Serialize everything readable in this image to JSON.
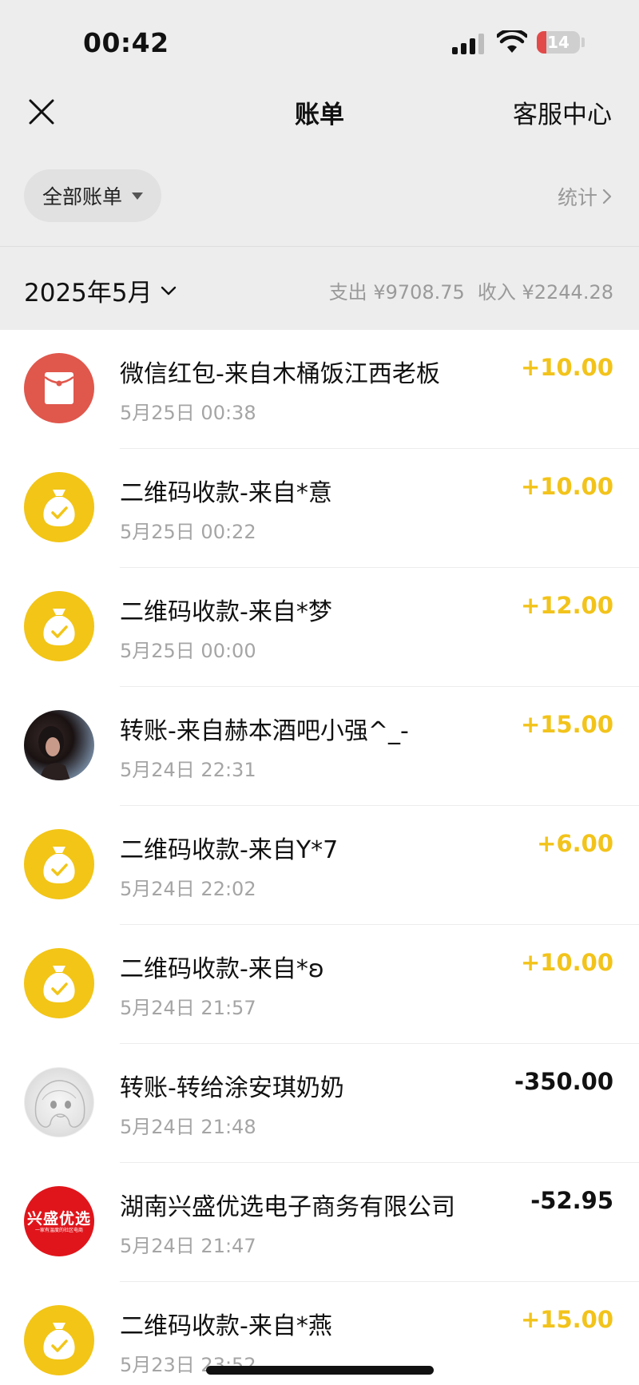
{
  "status_bar": {
    "time": "00:42",
    "battery": "14",
    "battery_level_percent": 14
  },
  "nav": {
    "title": "账单",
    "right_link": "客服中心"
  },
  "filter": {
    "label": "全部账单",
    "stats_label": "统计"
  },
  "month": {
    "label": "2025年5月",
    "expense": "支出 ¥9708.75",
    "income": "收入 ¥2244.28"
  },
  "colors": {
    "income_amount": "#f2c31b",
    "qr_avatar": "#f2c517",
    "red_packet": "#e0574c",
    "brand_red": "#e0151b"
  },
  "transactions": [
    {
      "title": "微信红包-来自木桶饭江西老板",
      "time": "5月25日 00:38",
      "amount": "+10.00",
      "icon": "red-packet-icon"
    },
    {
      "title": "二维码收款-来自*意",
      "time": "5月25日 00:22",
      "amount": "+10.00",
      "icon": "money-bag-icon"
    },
    {
      "title": "二维码收款-来自*梦",
      "time": "5月25日 00:00",
      "amount": "+12.00",
      "icon": "money-bag-icon"
    },
    {
      "title": "转账-来自赫本酒吧小强^_-",
      "time": "5月24日 22:31",
      "amount": "+15.00",
      "icon": "user-photo-avatar"
    },
    {
      "title": "二维码收款-来自Y*7",
      "time": "5月24日 22:02",
      "amount": "+6.00",
      "icon": "money-bag-icon"
    },
    {
      "title": "二维码收款-来自*ʚ",
      "time": "5月24日 21:57",
      "amount": "+10.00",
      "icon": "money-bag-icon"
    },
    {
      "title": "转账-转给涂安琪奶奶",
      "time": "5月24日 21:48",
      "amount": "-350.00",
      "icon": "anime-avatar"
    },
    {
      "title": "湖南兴盛优选电子商务有限公司",
      "time": "5月24日 21:47",
      "amount": "-52.95",
      "icon": "brand-logo",
      "brand_text": "兴盛优选",
      "brand_sub": "一家有温度的社区电商"
    },
    {
      "title": "二维码收款-来自*燕",
      "time": "5月23日 23:52",
      "amount": "+15.00",
      "icon": "money-bag-icon"
    }
  ]
}
